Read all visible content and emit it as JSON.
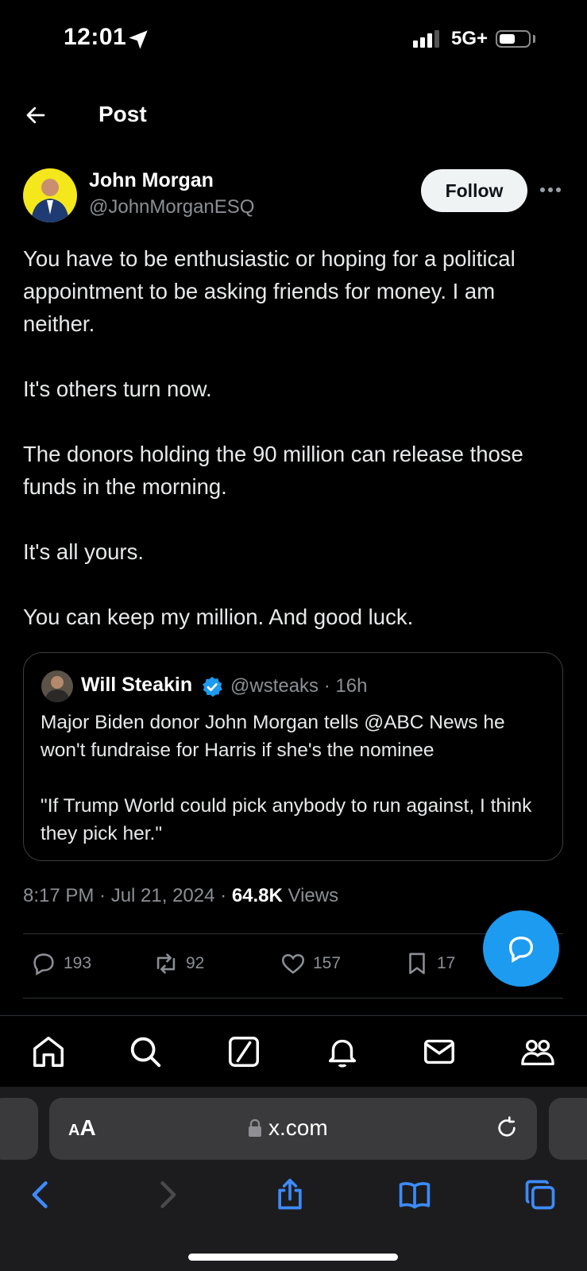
{
  "status_bar": {
    "time": "12:01",
    "network": "5G+",
    "signal_bars": 3,
    "battery_level": 0.55
  },
  "header": {
    "title": "Post",
    "back_icon": "arrow-left-icon"
  },
  "author": {
    "name": "John Morgan",
    "handle": "@JohnMorganESQ",
    "follow_label": "Follow"
  },
  "post": {
    "paragraphs": [
      "You have to be enthusiastic or hoping for a political appointment to be asking friends for money. I am neither.",
      "It's others turn now.",
      "The donors holding the 90 million can release those funds in the morning.",
      "It's all yours.",
      "You can keep my million. And good luck."
    ]
  },
  "quote": {
    "name": "Will Steakin",
    "handle_time": "@wsteaks · 16h",
    "paragraphs": [
      "Major Biden donor John Morgan tells @ABC News he won't fundraise for Harris if she's the nominee",
      "\"If Trump World could pick anybody to run against, I think they pick her.\""
    ]
  },
  "meta": {
    "timestamp": "8:17 PM · Jul 21, 2024 · ",
    "views_count": "64.8K",
    "views_label": " Views"
  },
  "actions": {
    "replies": "193",
    "reposts": "92",
    "likes": "157",
    "bookmarks": "17"
  },
  "browser": {
    "text_size_label": "AA",
    "url": "x.com"
  },
  "colors": {
    "accent": "#1d9bf0",
    "background": "#000000",
    "secondary_text": "#8b8f94"
  }
}
